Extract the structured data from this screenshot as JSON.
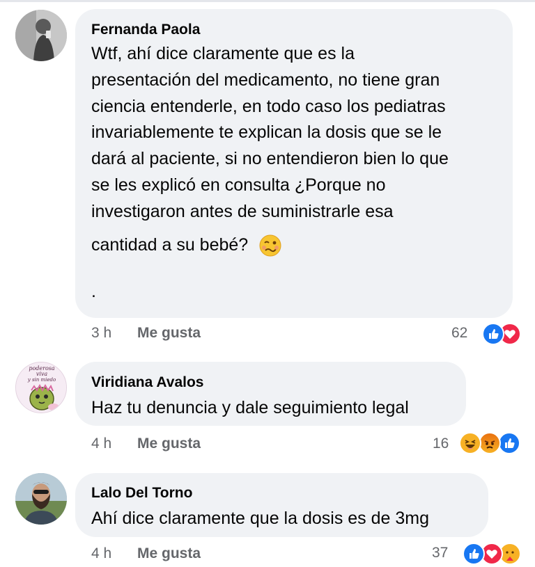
{
  "comments": [
    {
      "author": "Fernanda Paola",
      "lines": [
        "Wtf, ahí dice claramente que es la",
        "presentación del medicamento, no tiene gran",
        "ciencia entenderle, en todo caso los pediatras",
        "invariablemente te explican la dosis que se le",
        "dará al paciente, si no entendieron bien lo que",
        "se les explicó en consulta ¿Porque no",
        "investigaron antes de suministrarle esa",
        "cantidad a su bebé?",
        "."
      ],
      "time": "3 h",
      "like_label": "Me gusta",
      "reaction_count": "62",
      "reactions": [
        "like-icon",
        "love-icon"
      ]
    },
    {
      "author": "Viridiana Avalos",
      "avatar_text": [
        "poderosa",
        "viva",
        "y sin miedo"
      ],
      "lines": [
        "Haz tu denuncia y dale seguimiento legal"
      ],
      "time": "4 h",
      "like_label": "Me gusta",
      "reaction_count": "16",
      "reactions": [
        "haha-icon",
        "angry-icon",
        "like-icon"
      ]
    },
    {
      "author": "Lalo Del Torno",
      "lines": [
        "Ahí dice claramente que la dosis es de 3mg"
      ],
      "time": "4 h",
      "like_label": "Me gusta",
      "reaction_count": "37",
      "reactions": [
        "like-icon",
        "love-icon",
        "care-icon"
      ]
    }
  ],
  "colors": {
    "bubble": "#f0f2f5",
    "meta_text": "#65676b",
    "like_blue": "#1877f2",
    "love_red": "#f02849",
    "haha_yellow": "#f7b125"
  }
}
